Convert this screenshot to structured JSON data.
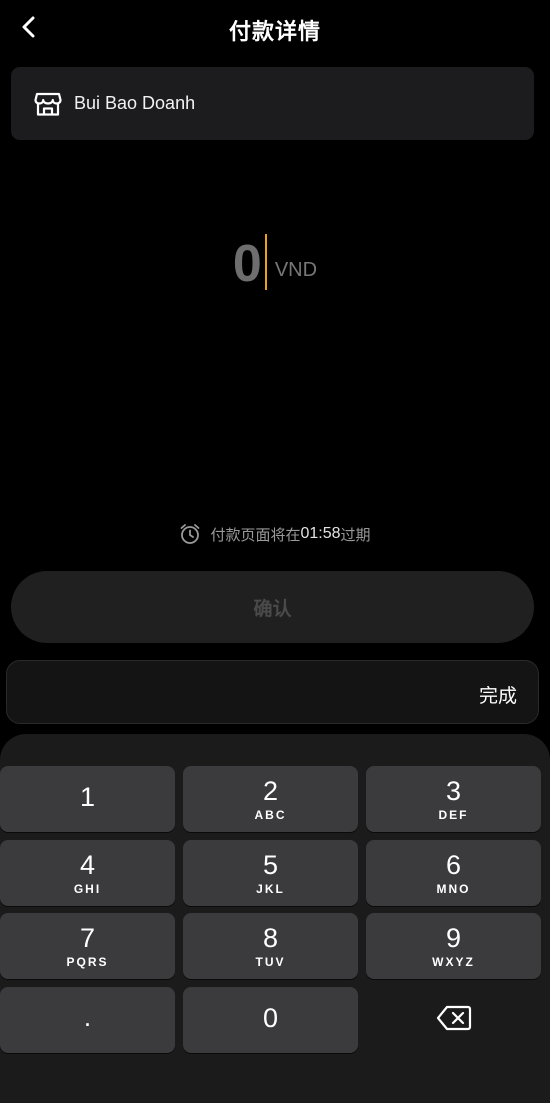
{
  "header": {
    "title": "付款详情",
    "back_icon": "chevron-left-icon"
  },
  "merchant": {
    "icon": "store-icon",
    "name": "Bui Bao Doanh"
  },
  "amount": {
    "value": "0",
    "currency": "VND",
    "caret_color": "#e8a317"
  },
  "timer": {
    "icon": "alarm-clock-icon",
    "prefix": "付款页面将在",
    "time": "01:58",
    "suffix": "过期"
  },
  "confirm": {
    "label": "确认",
    "state": "disabled"
  },
  "keyboard_toolbar": {
    "done_label": "完成"
  },
  "keypad": {
    "keys": [
      {
        "digit": "1",
        "letters": ""
      },
      {
        "digit": "2",
        "letters": "ABC"
      },
      {
        "digit": "3",
        "letters": "DEF"
      },
      {
        "digit": "4",
        "letters": "GHI"
      },
      {
        "digit": "5",
        "letters": "JKL"
      },
      {
        "digit": "6",
        "letters": "MNO"
      },
      {
        "digit": "7",
        "letters": "PQRS"
      },
      {
        "digit": "8",
        "letters": "TUV"
      },
      {
        "digit": "9",
        "letters": "WXYZ"
      },
      {
        "digit": ".",
        "letters": ""
      },
      {
        "digit": "0",
        "letters": ""
      }
    ],
    "backspace_icon": "backspace-icon"
  }
}
